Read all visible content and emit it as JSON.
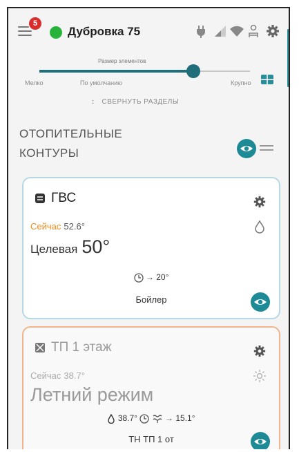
{
  "header": {
    "notification_count": "5",
    "device_title": "Дубровка 75",
    "status_color": "#27b33a",
    "icons": [
      "menu-icon",
      "plug-icon",
      "signal-icon",
      "wifi-icon",
      "person-icon",
      "gear-icon"
    ]
  },
  "slider": {
    "caption": "Размер элементов",
    "labels": [
      "Мелко",
      "По умолчанию",
      "Крупно"
    ],
    "value_fraction": 0.73,
    "accent": "#1f6e7a"
  },
  "collapse_label": "СВЕРНУТЬ РАЗДЕЛЫ",
  "section": {
    "title_line1": "ОТОПИТЕЛЬНЫЕ",
    "title_line2": "КОНТУРЫ"
  },
  "cards": [
    {
      "name": "ГВС",
      "now_label": "Сейчас",
      "now_value": "52.6°",
      "target_label": "Целевая",
      "target_value": "50°",
      "info_value": "→ 20°",
      "mode": "Бойлер",
      "border_color": "#b6d8e4"
    },
    {
      "name": "ТП 1 этаж",
      "now_label": "Сейчас",
      "now_value": "38.7°",
      "status": "Летний режим",
      "info_a": "38.7°",
      "info_b": "→ 15.1°",
      "mode": "ТН ТП 1 от",
      "border_color": "#f0b58c"
    }
  ]
}
